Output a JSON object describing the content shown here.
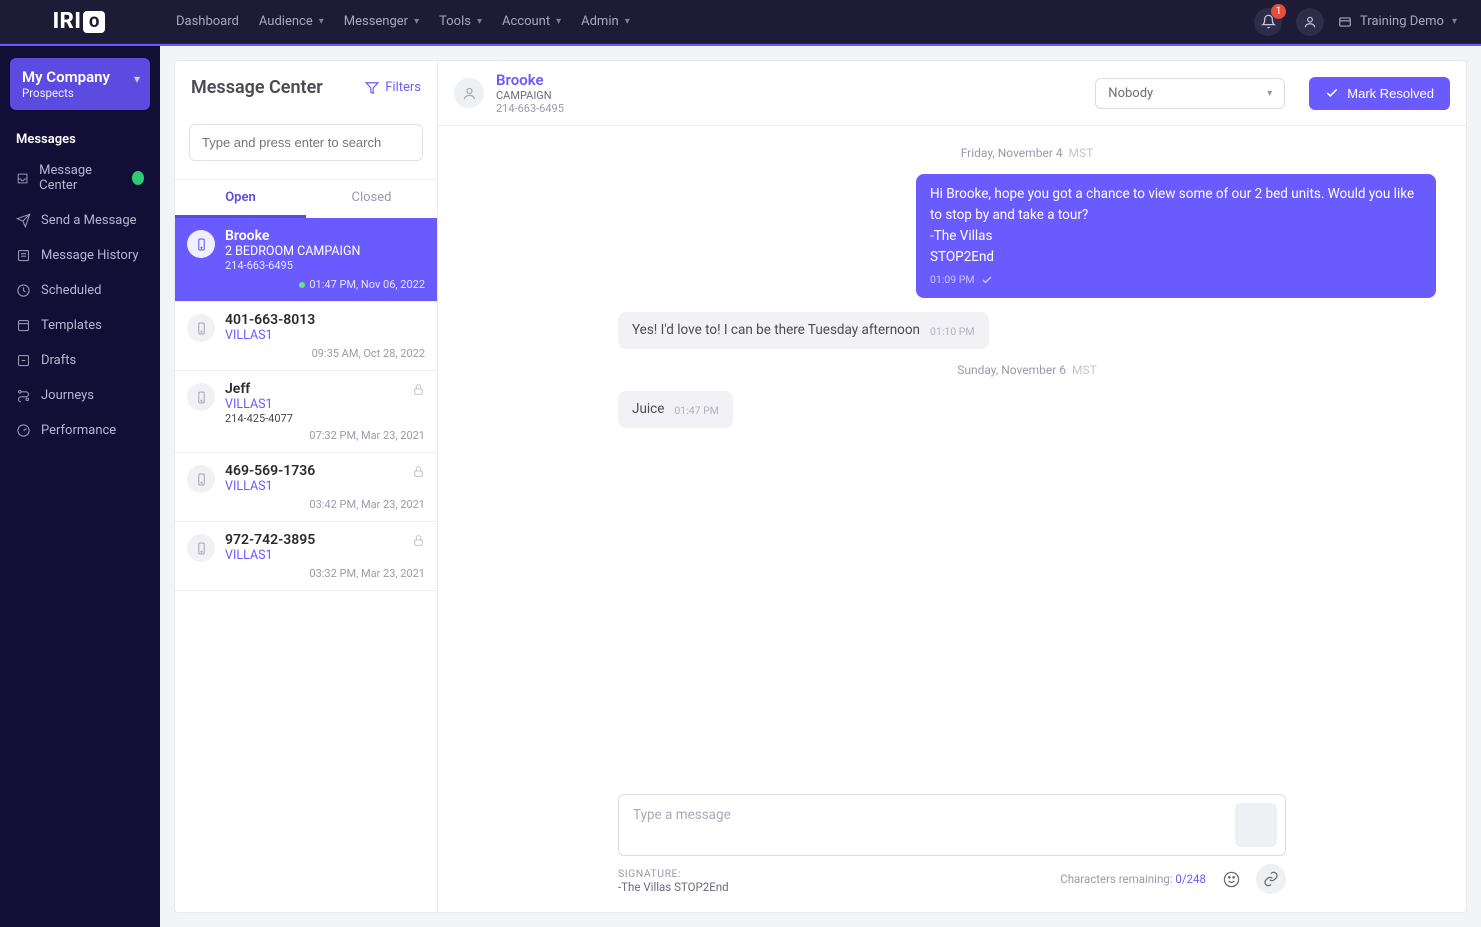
{
  "topnav": {
    "logo": "IRI",
    "links": [
      "Dashboard",
      "Audience",
      "Messenger",
      "Tools",
      "Account",
      "Admin"
    ],
    "links_chevron": [
      false,
      true,
      true,
      true,
      true,
      true
    ],
    "notif_count": "1",
    "profile_label": "Training Demo"
  },
  "sidebar": {
    "company_title": "My Company",
    "company_sub": "Prospects",
    "section": "Messages",
    "items": [
      {
        "label": "Message Center",
        "icon": "inbox",
        "dot": true
      },
      {
        "label": "Send a Message",
        "icon": "send",
        "dot": false
      },
      {
        "label": "Message History",
        "icon": "history",
        "dot": false
      },
      {
        "label": "Scheduled",
        "icon": "clock",
        "dot": false
      },
      {
        "label": "Templates",
        "icon": "template",
        "dot": false
      },
      {
        "label": "Drafts",
        "icon": "draft",
        "dot": false
      },
      {
        "label": "Journeys",
        "icon": "journey",
        "dot": false
      },
      {
        "label": "Performance",
        "icon": "performance",
        "dot": false
      }
    ]
  },
  "listpanel": {
    "title": "Message Center",
    "filters": "Filters",
    "search_placeholder": "Type and press enter to search",
    "tab_open": "Open",
    "tab_closed": "Closed",
    "conversations": [
      {
        "name": "Brooke",
        "campaign": "2 BEDROOM CAMPAIGN",
        "phone": "214-663-6495",
        "timestamp": "01:47 PM, Nov 06, 2022",
        "active": true,
        "lock": false,
        "dot": true
      },
      {
        "name": "401-663-8013",
        "campaign": "VILLAS1",
        "phone": "",
        "timestamp": "09:35 AM, Oct 28, 2022",
        "active": false,
        "lock": false,
        "dot": false
      },
      {
        "name": "Jeff",
        "campaign": "VILLAS1",
        "phone": "214-425-4077",
        "timestamp": "07:32 PM, Mar 23, 2021",
        "active": false,
        "lock": true,
        "dot": false
      },
      {
        "name": "469-569-1736",
        "campaign": "VILLAS1",
        "phone": "",
        "timestamp": "03:42 PM, Mar 23, 2021",
        "active": false,
        "lock": true,
        "dot": false
      },
      {
        "name": "972-742-3895",
        "campaign": "VILLAS1",
        "phone": "",
        "timestamp": "03:32 PM, Mar 23, 2021",
        "active": false,
        "lock": true,
        "dot": false
      }
    ]
  },
  "chat": {
    "name": "Brooke",
    "campaign": "CAMPAIGN",
    "phone": "214-663-6495",
    "assignee": "Nobody",
    "resolve": "Mark Resolved",
    "days": [
      {
        "label": "Friday, November 4",
        "tz": "MST",
        "msgs": [
          {
            "dir": "out",
            "body": "Hi Brooke, hope you got a chance to view some of our 2 bed units. Would you like to stop by and take a tour?\n-The Villas\nSTOP2End",
            "time": "01:09 PM"
          },
          {
            "dir": "in",
            "body": "Yes! I'd love to! I can be there Tuesday afternoon",
            "time": "01:10 PM"
          }
        ]
      },
      {
        "label": "Sunday, November 6",
        "tz": "MST",
        "msgs": [
          {
            "dir": "in",
            "body": "Juice",
            "time": "01:47 PM"
          }
        ]
      }
    ],
    "composer_placeholder": "Type a message",
    "signature_label": "SIGNATURE:",
    "signature": "-The Villas STOP2End",
    "chars_label": "Characters remaining: ",
    "chars_value": "0/248"
  }
}
